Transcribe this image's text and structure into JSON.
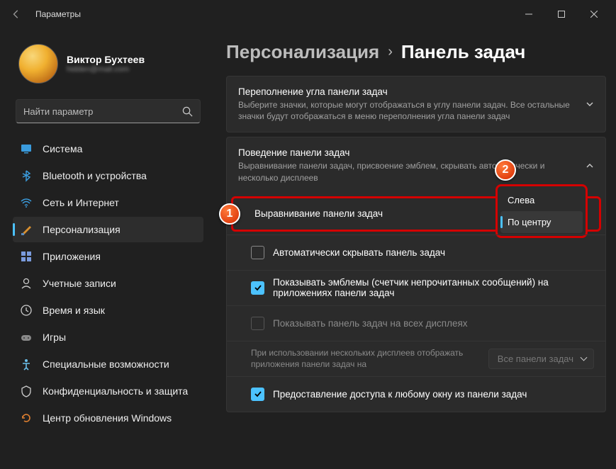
{
  "titlebar": {
    "title": "Параметры"
  },
  "profile": {
    "name": "Виктор Бухтеев",
    "email": "hidden@mail.com"
  },
  "search": {
    "placeholder": "Найти параметр"
  },
  "nav": [
    {
      "label": "Система",
      "icon": "system",
      "active": false
    },
    {
      "label": "Bluetooth и устройства",
      "icon": "bluetooth",
      "active": false
    },
    {
      "label": "Сеть и Интернет",
      "icon": "wifi",
      "active": false
    },
    {
      "label": "Персонализация",
      "icon": "brush",
      "active": true
    },
    {
      "label": "Приложения",
      "icon": "apps",
      "active": false
    },
    {
      "label": "Учетные записи",
      "icon": "account",
      "active": false
    },
    {
      "label": "Время и язык",
      "icon": "clock",
      "active": false
    },
    {
      "label": "Игры",
      "icon": "game",
      "active": false
    },
    {
      "label": "Специальные возможности",
      "icon": "access",
      "active": false
    },
    {
      "label": "Конфиденциальность и защита",
      "icon": "privacy",
      "active": false
    },
    {
      "label": "Центр обновления Windows",
      "icon": "update",
      "active": false
    }
  ],
  "breadcrumb": {
    "parent": "Персонализация",
    "sep": "›",
    "current": "Панель задач"
  },
  "overflow": {
    "title": "Переполнение угла панели задач",
    "desc": "Выберите значки, которые могут отображаться в углу панели задач. Все остальные значки будут отображаться в меню переполнения угла панели задач"
  },
  "behavior": {
    "title": "Поведение панели задач",
    "desc": "Выравнивание панели задач, присвоение эмблем, скрывать автоматически и несколько дисплеев",
    "alignment_label": "Выравнивание панели задач",
    "alignment_options": {
      "left": "Слева",
      "center": "По центру"
    },
    "auto_hide": "Автоматически скрывать панель задач",
    "badges": "Показывать эмблемы (счетчик непрочитанных сообщений) на приложениях панели задач",
    "all_displays": "Показывать панель задач на всех дисплеях",
    "multi_display_label": "При использовании нескольких дисплеев отображать приложения панели задач на",
    "multi_display_value": "Все панели задач",
    "window_access": "Предоставление доступа к любому окну из панели задач"
  },
  "badges": {
    "one": "1",
    "two": "2"
  }
}
